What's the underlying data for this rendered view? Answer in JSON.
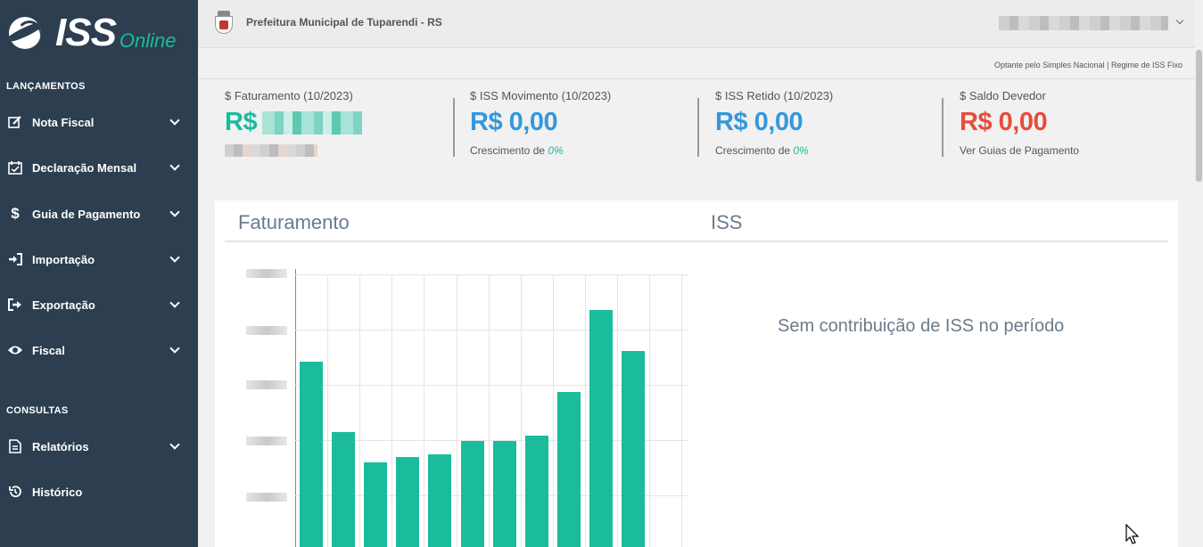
{
  "logo": {
    "main": "ISS",
    "sub": "Online"
  },
  "sidebar": {
    "section_lancamentos": "LANÇAMENTOS",
    "section_consultas": "CONSULTAS",
    "items": [
      {
        "label": "Nota Fiscal",
        "icon": "edit-icon"
      },
      {
        "label": "Declaração Mensal",
        "icon": "calendar-check-icon"
      },
      {
        "label": "Guia de Pagamento",
        "icon": "dollar-icon"
      },
      {
        "label": "Importação",
        "icon": "sign-in-icon"
      },
      {
        "label": "Exportação",
        "icon": "sign-out-icon"
      },
      {
        "label": "Fiscal",
        "icon": "eye-icon"
      },
      {
        "label": "Relatórios",
        "icon": "file-icon"
      },
      {
        "label": "Histórico",
        "icon": "history-icon"
      }
    ]
  },
  "header": {
    "org_name": "Prefeitura Municipal de Tuparendi - RS",
    "regime": "Optante pelo Simples Nacional | Regime de ISS Fixo"
  },
  "kpis": [
    {
      "label": "$ Faturamento (10/2023)",
      "value": "R$",
      "color": "#1abc9c"
    },
    {
      "label": "$ ISS Movimento (10/2023)",
      "value": "R$ 0,00",
      "sub_prefix": "Crescimento de ",
      "sub_value": "0%",
      "color": "#3498db"
    },
    {
      "label": "$ ISS Retido (10/2023)",
      "value": "R$ 0,00",
      "sub_prefix": "Crescimento de ",
      "sub_value": "0%",
      "color": "#3498db"
    },
    {
      "label": "$ Saldo Devedor",
      "value": "R$ 0,00",
      "sub": "Ver Guias de Pagamento",
      "color": "#e74c3c"
    }
  ],
  "panel": {
    "title_left": "Faturamento",
    "title_right": "ISS",
    "empty_message": "Sem contribuição de ISS no período"
  },
  "chart_data": {
    "type": "bar",
    "title": "Faturamento",
    "values": [
      0.68,
      0.42,
      0.31,
      0.33,
      0.34,
      0.39,
      0.39,
      0.41,
      0.57,
      0.87,
      0.72
    ],
    "note": "axis tick labels are blurred in the original; values are relative heights (fraction of visible axis range)"
  }
}
